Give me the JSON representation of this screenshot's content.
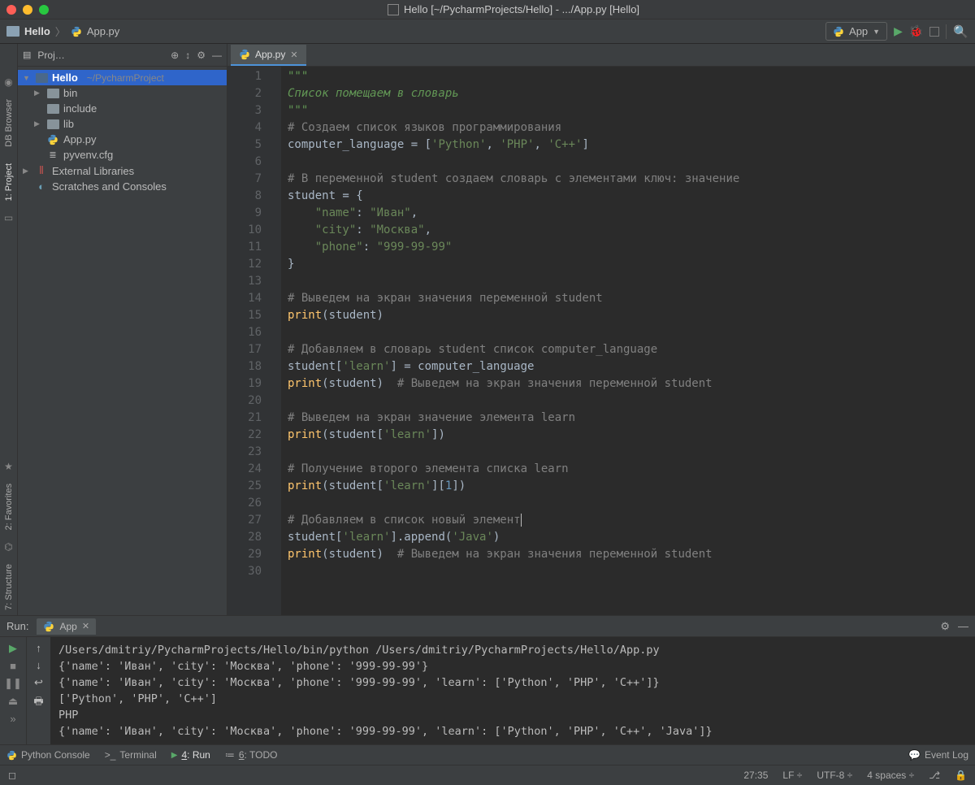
{
  "window": {
    "title": "Hello [~/PycharmProjects/Hello] - .../App.py [Hello]"
  },
  "breadcrumb": {
    "project": "Hello",
    "file": "App.py"
  },
  "runConfig": {
    "name": "App"
  },
  "leftRail": {
    "dbBrowser": "DB Browser",
    "project": "1: Project",
    "favorites": "2: Favorites",
    "structure": "7: Structure"
  },
  "projectPanel": {
    "header": "Proj…",
    "root": {
      "name": "Hello",
      "path": "~/PycharmProject"
    },
    "nodes": {
      "bin": "bin",
      "include": "include",
      "lib": "lib",
      "app": "App.py",
      "cfg": "pyvenv.cfg",
      "ext": "External Libraries",
      "scratch": "Scratches and Consoles"
    }
  },
  "editor": {
    "tabName": "App.py",
    "lineCount": 30,
    "lines": [
      {
        "n": 1,
        "tokens": [
          {
            "t": "\"\"\"",
            "c": "c-doc"
          }
        ]
      },
      {
        "n": 2,
        "tokens": [
          {
            "t": "Список помещаем в словарь",
            "c": "c-doc"
          }
        ]
      },
      {
        "n": 3,
        "tokens": [
          {
            "t": "\"\"\"",
            "c": "c-doc"
          }
        ]
      },
      {
        "n": 4,
        "tokens": [
          {
            "t": "# Создаем список языков программирования",
            "c": "c-cmt"
          }
        ]
      },
      {
        "n": 5,
        "tokens": [
          {
            "t": "computer_language = ["
          },
          {
            "t": "'Python'",
            "c": "c-str"
          },
          {
            "t": ", "
          },
          {
            "t": "'PHP'",
            "c": "c-str"
          },
          {
            "t": ", "
          },
          {
            "t": "'C++'",
            "c": "c-str"
          },
          {
            "t": "]"
          }
        ]
      },
      {
        "n": 6,
        "tokens": []
      },
      {
        "n": 7,
        "tokens": [
          {
            "t": "# В переменной student создаем словарь с элементами ключ: значение",
            "c": "c-cmt"
          }
        ]
      },
      {
        "n": 8,
        "tokens": [
          {
            "t": "student = {"
          }
        ]
      },
      {
        "n": 9,
        "tokens": [
          {
            "t": "    "
          },
          {
            "t": "\"name\"",
            "c": "c-str"
          },
          {
            "t": ": "
          },
          {
            "t": "\"Иван\"",
            "c": "c-str"
          },
          {
            "t": ","
          }
        ]
      },
      {
        "n": 10,
        "tokens": [
          {
            "t": "    "
          },
          {
            "t": "\"city\"",
            "c": "c-str"
          },
          {
            "t": ": "
          },
          {
            "t": "\"Москва\"",
            "c": "c-str"
          },
          {
            "t": ","
          }
        ]
      },
      {
        "n": 11,
        "tokens": [
          {
            "t": "    "
          },
          {
            "t": "\"phone\"",
            "c": "c-str"
          },
          {
            "t": ": "
          },
          {
            "t": "\"999-99-99\"",
            "c": "c-str"
          }
        ]
      },
      {
        "n": 12,
        "tokens": [
          {
            "t": "}"
          }
        ]
      },
      {
        "n": 13,
        "tokens": []
      },
      {
        "n": 14,
        "tokens": [
          {
            "t": "# Выведем на экран значения переменной student",
            "c": "c-cmt"
          }
        ]
      },
      {
        "n": 15,
        "tokens": [
          {
            "t": "print",
            "c": "c-fn"
          },
          {
            "t": "(student)"
          }
        ]
      },
      {
        "n": 16,
        "tokens": []
      },
      {
        "n": 17,
        "tokens": [
          {
            "t": "# Добавляем в словарь student список computer_language",
            "c": "c-cmt"
          }
        ]
      },
      {
        "n": 18,
        "tokens": [
          {
            "t": "student["
          },
          {
            "t": "'learn'",
            "c": "c-str"
          },
          {
            "t": "] = computer_language"
          }
        ]
      },
      {
        "n": 19,
        "tokens": [
          {
            "t": "print",
            "c": "c-fn"
          },
          {
            "t": "(student)  "
          },
          {
            "t": "# Выведем на экран значения переменной student",
            "c": "c-cmt"
          }
        ]
      },
      {
        "n": 20,
        "tokens": []
      },
      {
        "n": 21,
        "tokens": [
          {
            "t": "# Выведем на экран значение элемента learn",
            "c": "c-cmt"
          }
        ]
      },
      {
        "n": 22,
        "tokens": [
          {
            "t": "print",
            "c": "c-fn"
          },
          {
            "t": "(student["
          },
          {
            "t": "'learn'",
            "c": "c-str"
          },
          {
            "t": "])"
          }
        ]
      },
      {
        "n": 23,
        "tokens": []
      },
      {
        "n": 24,
        "tokens": [
          {
            "t": "# Получение второго элемента списка learn",
            "c": "c-cmt"
          }
        ]
      },
      {
        "n": 25,
        "tokens": [
          {
            "t": "print",
            "c": "c-fn"
          },
          {
            "t": "(student["
          },
          {
            "t": "'learn'",
            "c": "c-str"
          },
          {
            "t": "]["
          },
          {
            "t": "1",
            "c": "c-num"
          },
          {
            "t": "])"
          }
        ]
      },
      {
        "n": 26,
        "tokens": []
      },
      {
        "n": 27,
        "tokens": [
          {
            "t": "# Добавляем в список новый элемент",
            "c": "c-cmt"
          },
          {
            "t": "",
            "cursor": true
          }
        ]
      },
      {
        "n": 28,
        "tokens": [
          {
            "t": "student["
          },
          {
            "t": "'learn'",
            "c": "c-str"
          },
          {
            "t": "].append("
          },
          {
            "t": "'Java'",
            "c": "c-str"
          },
          {
            "t": ")"
          }
        ]
      },
      {
        "n": 29,
        "tokens": [
          {
            "t": "print",
            "c": "c-fn"
          },
          {
            "t": "(student)  "
          },
          {
            "t": "# Выведем на экран значения переменной student",
            "c": "c-cmt"
          }
        ]
      },
      {
        "n": 30,
        "tokens": []
      }
    ]
  },
  "runPanel": {
    "label": "Run:",
    "tabName": "App",
    "output": [
      "/Users/dmitriy/PycharmProjects/Hello/bin/python /Users/dmitriy/PycharmProjects/Hello/App.py",
      "{'name': 'Иван', 'city': 'Москва', 'phone': '999-99-99'}",
      "{'name': 'Иван', 'city': 'Москва', 'phone': '999-99-99', 'learn': ['Python', 'PHP', 'C++']}",
      "['Python', 'PHP', 'C++']",
      "PHP",
      "{'name': 'Иван', 'city': 'Москва', 'phone': '999-99-99', 'learn': ['Python', 'PHP', 'C++', 'Java']}"
    ]
  },
  "bottomTabs": {
    "pythonConsole": "Python Console",
    "terminal": "Terminal",
    "run": "4: Run",
    "todo": "6: TODO",
    "eventLog": "Event Log"
  },
  "status": {
    "pos": "27:35",
    "lineSep": "LF",
    "encoding": "UTF-8",
    "indent": "4 spaces"
  }
}
